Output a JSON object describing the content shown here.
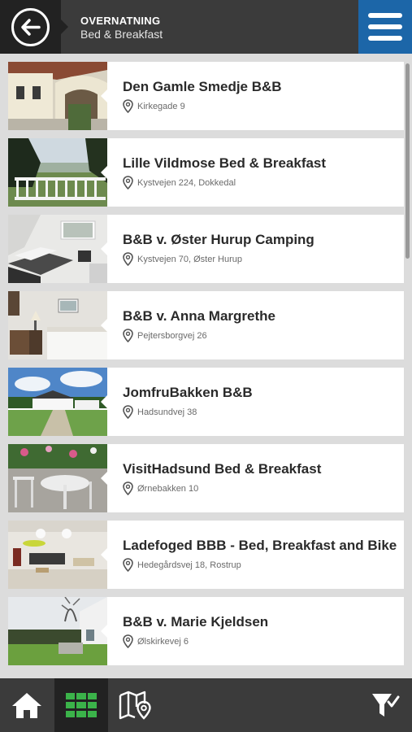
{
  "header": {
    "category": "OVERNATNING",
    "subcategory": "Bed & Breakfast"
  },
  "listings": [
    {
      "name": "Den Gamle Smedje B&B",
      "address": "Kirkegade 9"
    },
    {
      "name": "Lille Vildmose Bed & Breakfast",
      "address": "Kystvejen 224, Dokkedal"
    },
    {
      "name": "B&B v. Øster Hurup Camping",
      "address": "Kystvejen 70, Øster Hurup"
    },
    {
      "name": "B&B v. Anna Margrethe",
      "address": "Pejtersborgvej 26"
    },
    {
      "name": "JomfruBakken B&B",
      "address": "Hadsundvej 38"
    },
    {
      "name": "VisitHadsund Bed & Breakfast",
      "address": "Ørnebakken 10"
    },
    {
      "name": "Ladefoged BBB - Bed, Breakfast and Bike",
      "address": "Hedegårdsvej 18, Rostrup"
    },
    {
      "name": "B&B v. Marie Kjeldsen",
      "address": "Ølskirkevej 6"
    }
  ],
  "bottom_nav": {
    "icons": [
      "home-icon",
      "grid-icon",
      "map-icon",
      "filter-icon"
    ],
    "active": "grid-icon"
  },
  "colors": {
    "topbar": "#3b3b3b",
    "menu_button": "#1c66a8",
    "active_tab_icon": "#3bb34a",
    "background": "#dcdcdc"
  }
}
